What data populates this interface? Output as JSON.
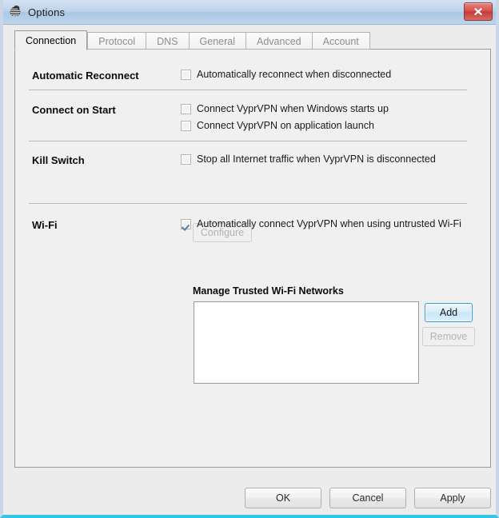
{
  "window": {
    "title": "Options",
    "app_icon": "vyprvpn-swirl-icon",
    "close_label": "×",
    "accent_bottom_color": "#2fc6e8",
    "titlebar_color": "#bcd2ea"
  },
  "tabs": [
    {
      "label": "Connection",
      "active": true
    },
    {
      "label": "Protocol",
      "active": false
    },
    {
      "label": "DNS",
      "active": false
    },
    {
      "label": "General",
      "active": false
    },
    {
      "label": "Advanced",
      "active": false
    },
    {
      "label": "Account",
      "active": false
    }
  ],
  "sections": {
    "automatic_reconnect": {
      "label": "Automatic Reconnect",
      "checkbox": {
        "label": "Automatically reconnect when disconnected",
        "checked": false,
        "enabled": false
      }
    },
    "connect_on_start": {
      "label": "Connect on Start",
      "checkbox_windows": {
        "label": "Connect VyprVPN when Windows starts up",
        "checked": false,
        "enabled": false
      },
      "checkbox_launch": {
        "label": "Connect VyprVPN on application launch",
        "checked": false,
        "enabled": false
      }
    },
    "kill_switch": {
      "label": "Kill Switch",
      "checkbox": {
        "label": "Stop all Internet traffic when VyprVPN is disconnected",
        "checked": false,
        "enabled": false
      },
      "configure_button": {
        "label": "Configure",
        "enabled": false
      }
    },
    "wifi": {
      "label": "Wi-Fi",
      "checkbox": {
        "label": "Automatically connect VyprVPN when using untrusted Wi-Fi",
        "checked": true,
        "enabled": false
      },
      "manage_title": "Manage Trusted Wi-Fi Networks",
      "list_items": [],
      "add_button": {
        "label": "Add",
        "enabled": true,
        "focused": true
      },
      "remove_button": {
        "label": "Remove",
        "enabled": false
      }
    }
  },
  "footer": {
    "ok_label": "OK",
    "cancel_label": "Cancel",
    "apply_label": "Apply"
  }
}
